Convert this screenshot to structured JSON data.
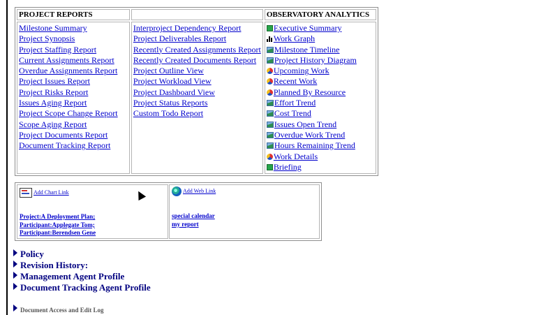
{
  "reports": {
    "header_left": "PROJECT REPORTS",
    "header_middle": "",
    "header_right": "OBSERVATORY ANALYTICS",
    "col1": [
      "Milestone Summary",
      "Project Synopsis",
      "Project Staffing Report",
      "Current Assignments Report",
      "Overdue Assignments Report",
      "Project Issues Report",
      "Project Risks Report",
      "Issues Aging Report",
      "Project Scope Change Report",
      "Scope Aging Report",
      "Project Documents Report",
      "Document Tracking Report"
    ],
    "col2": [
      "Interproject Dependency Report",
      "Project Deliverables Report",
      "Recently Created Assignments Report",
      "Recently Created Documents Report",
      "Project Outline View",
      "Project Workload View",
      "Project Dashboard View",
      "Project Status Reports",
      "Custom Todo Report"
    ],
    "analytics": [
      {
        "label": "Executive Summary",
        "icon": "spreadsheet-icon"
      },
      {
        "label": "Work Graph",
        "icon": "bar-chart-icon"
      },
      {
        "label": "Milestone Timeline",
        "icon": "line-chart-icon"
      },
      {
        "label": "Project History Diagram",
        "icon": "line-chart-icon"
      },
      {
        "label": "Upcoming Work",
        "icon": "pie-chart-icon"
      },
      {
        "label": "Recent Work",
        "icon": "pie-chart-icon"
      },
      {
        "label": "Planned By Resource",
        "icon": "pie-chart-icon"
      },
      {
        "label": "Effort Trend",
        "icon": "line-chart-icon"
      },
      {
        "label": "Cost Trend",
        "icon": "line-chart-icon"
      },
      {
        "label": "Issues Open Trend",
        "icon": "line-chart-icon"
      },
      {
        "label": "Overdue Work Trend",
        "icon": "line-chart-icon"
      },
      {
        "label": "Hours Remaining Trend",
        "icon": "line-chart-icon"
      },
      {
        "label": "Work Details",
        "icon": "pie-chart-icon"
      },
      {
        "label": "Briefing",
        "icon": "spreadsheet-icon"
      }
    ]
  },
  "links": {
    "add_chart": "Add Chart Link",
    "chart_links": [
      "Project:A Deployment Plan;",
      "Participant:Applegate Tom;",
      "Participant:Berendsen Gene"
    ],
    "add_web": "Add Web Link",
    "web_links": [
      "special calendar",
      "my report"
    ]
  },
  "sections": {
    "policy": "Policy",
    "revision": "Revision History:",
    "management": "Management Agent Profile",
    "doc_tracking": "Document Tracking Agent Profile",
    "access_log": "Document Access and Edit Log"
  }
}
